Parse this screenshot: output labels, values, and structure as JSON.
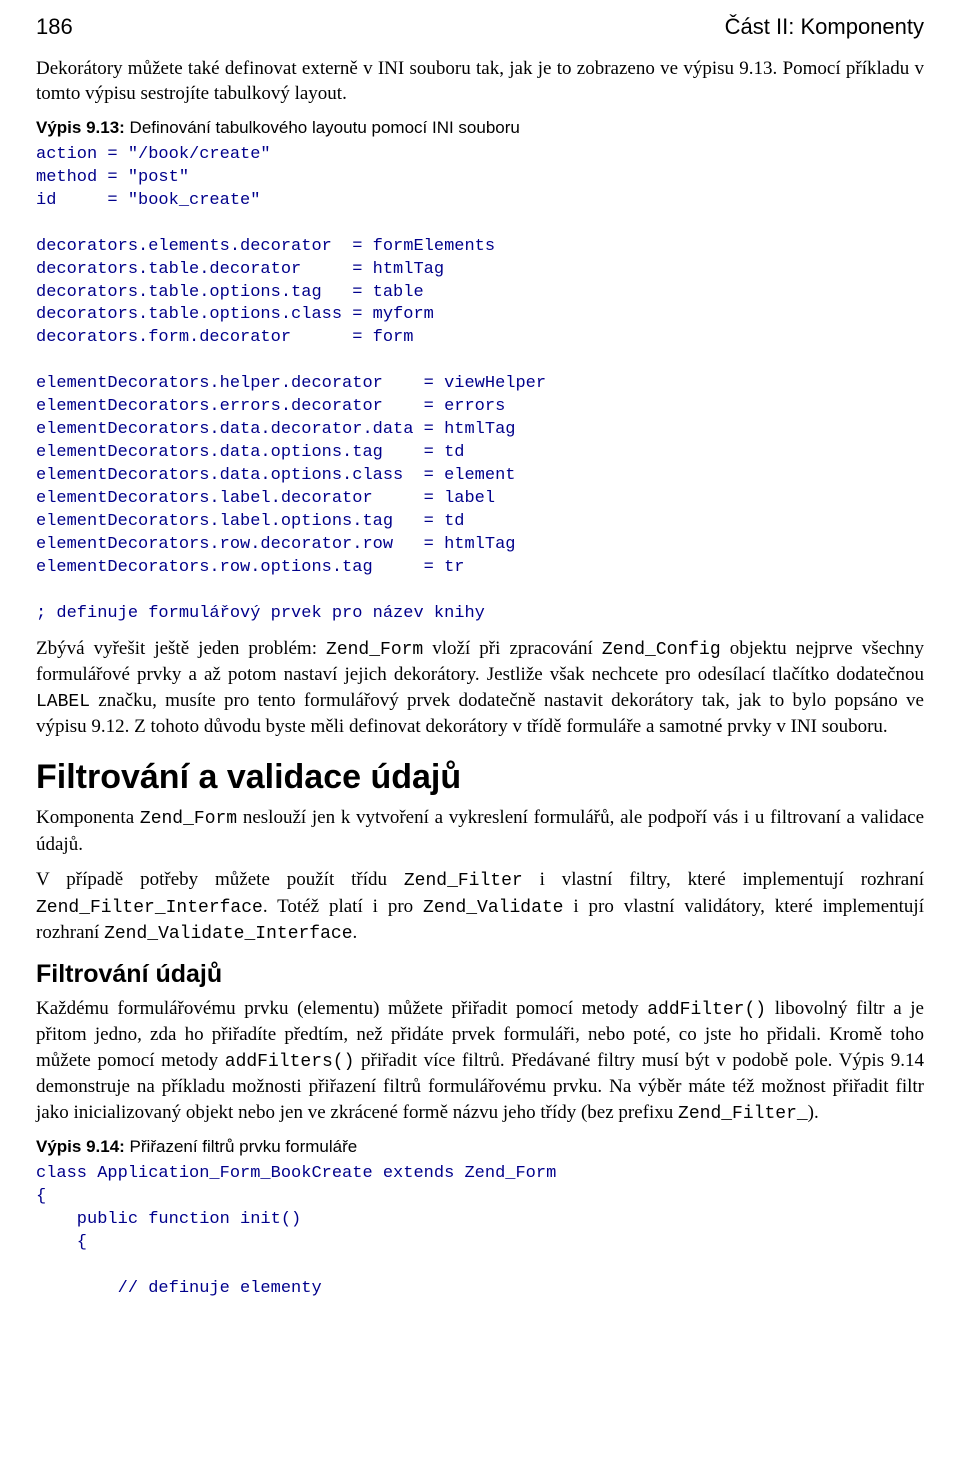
{
  "running_head": {
    "page_number": "186",
    "section": "Část II: Komponenty"
  },
  "p1": {
    "pre": "Dekorátory můžete také definovat externě v INI souboru tak, jak je to zobrazeno ve výpisu 9.13. Pomocí příkladu v tomto výpisu sestrojíte tabulkový layout."
  },
  "listing913": {
    "label": "Výpis 9.13:",
    "caption": " Definování tabulkového layoutu pomocí INI souboru"
  },
  "code913": "action = \"/book/create\"\nmethod = \"post\"\nid     = \"book_create\"\n\ndecorators.elements.decorator  = formElements\ndecorators.table.decorator     = htmlTag\ndecorators.table.options.tag   = table\ndecorators.table.options.class = myform\ndecorators.form.decorator      = form\n\nelementDecorators.helper.decorator    = viewHelper\nelementDecorators.errors.decorator    = errors\nelementDecorators.data.decorator.data = htmlTag\nelementDecorators.data.options.tag    = td\nelementDecorators.data.options.class  = element\nelementDecorators.label.decorator     = label\nelementDecorators.label.options.tag   = td\nelementDecorators.row.decorator.row   = htmlTag\nelementDecorators.row.options.tag     = tr\n\n; definuje formulářový prvek pro název knihy",
  "p2": {
    "t1": "Zbývá vyřešit ještě jeden problém: ",
    "m1": "Zend_Form",
    "t2": " vloží při zpracování ",
    "m2": "Zend_Config",
    "t3": " objektu nejprve všechny formulářové prvky a až potom nastaví jejich dekorátory. Jestliže však nechcete pro odesílací tlačítko dodatečnou ",
    "m3": "LABEL",
    "t4": " značku, musíte pro tento formulářový prvek dodatečně nastavit dekorátory tak, jak to bylo popsáno ve výpisu 9.12. Z tohoto důvodu byste měli definovat dekorátory v třídě formuláře a samotné prvky v INI souboru."
  },
  "h2": "Filtrování a validace údajů",
  "p3": {
    "t1": "Komponenta ",
    "m1": "Zend_Form",
    "t2": " neslouží jen k vytvoření a vykreslení formulářů, ale podpoří vás i u filtrovaní a validace údajů."
  },
  "p4": {
    "t1": "V případě potřeby můžete použít třídu ",
    "m1": "Zend_Filter",
    "t2": " i vlastní filtry, které implementují rozhraní ",
    "m2": "Zend_Filter_Interface",
    "t3": ". Totéž platí i pro ",
    "m3": "Zend_Validate",
    "t4": " i pro vlastní validátory, které implementují rozhraní ",
    "m4": "Zend_Validate_Interface",
    "t5": "."
  },
  "h3": "Filtrování údajů",
  "p5": {
    "t1": "Každému formulářovému prvku (elementu) můžete přiřadit pomocí metody ",
    "m1": "addFilter()",
    "t2": " libovolný filtr a je přitom jedno, zda ho přiřadíte předtím, než přidáte prvek formuláři, nebo poté, co jste ho přidali. Kromě toho můžete pomocí metody ",
    "m2": "addFilters()",
    "t3": " přiřadit více filtrů. Předávané filtry musí být v podobě pole. Výpis 9.14 demonstruje na příkladu možnosti přiřazení filtrů formulářovému prvku. Na výběr máte též možnost přiřadit filtr jako inicializovaný objekt nebo jen ve zkrácené formě názvu jeho třídy (bez prefixu ",
    "m3": "Zend_Filter_",
    "t4": ")."
  },
  "listing914": {
    "label": "Výpis 9.14:",
    "caption": " Přiřazení filtrů prvku formuláře"
  },
  "code914": "class Application_Form_BookCreate extends Zend_Form\n{\n    public function init()\n    {\n\n        // definuje elementy"
}
